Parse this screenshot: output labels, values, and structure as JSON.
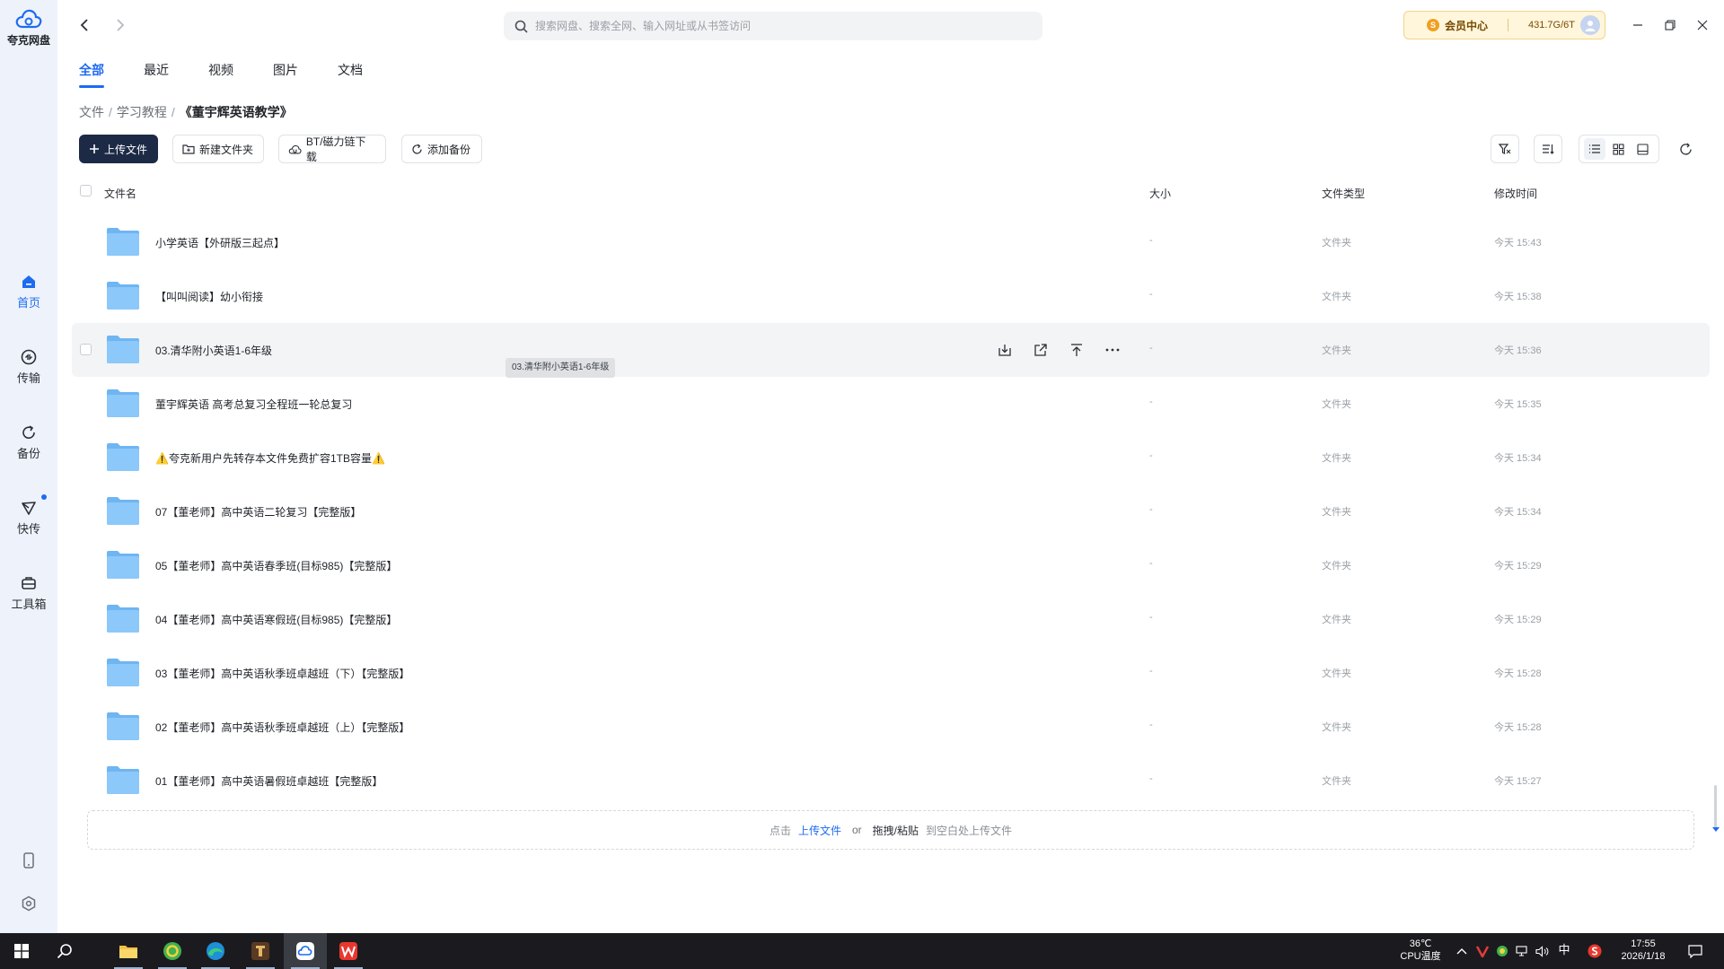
{
  "app": {
    "logo_text": "夸克网盘",
    "brand_color": "#1e6bf2"
  },
  "rail": {
    "items": [
      {
        "label": "首页",
        "icon": "home-icon",
        "active": true
      },
      {
        "label": "传输",
        "icon": "transfer-icon",
        "active": false
      },
      {
        "label": "备份",
        "icon": "backup-icon",
        "active": false
      },
      {
        "label": "快传",
        "icon": "quick-send-icon",
        "active": false
      },
      {
        "label": "工具箱",
        "icon": "toolbox-icon",
        "active": false
      }
    ],
    "bottom_icons": [
      "phone-icon",
      "settings-icon"
    ]
  },
  "header": {
    "search_placeholder": "搜索网盘、搜索全网、输入网址或从书签访问",
    "vip_label": "会员中心",
    "storage": "431.7G/6T"
  },
  "tabs": [
    {
      "label": "全部",
      "active": true
    },
    {
      "label": "最近",
      "active": false
    },
    {
      "label": "视频",
      "active": false
    },
    {
      "label": "图片",
      "active": false
    },
    {
      "label": "文档",
      "active": false
    }
  ],
  "breadcrumb": [
    "文件",
    "学习教程",
    "《董宇辉英语教学》"
  ],
  "toolbar": {
    "upload": "上传文件",
    "new_folder": "新建文件夹",
    "bt": "BT/磁力链下载",
    "backup": "添加备份"
  },
  "table": {
    "headers": {
      "name": "文件名",
      "size": "大小",
      "type": "文件类型",
      "modified": "修改时间"
    },
    "rows": [
      {
        "name": "小学英语【外研版三起点】",
        "size": "-",
        "type": "文件夹",
        "modified": "今天 15:43"
      },
      {
        "name": "【叫叫阅读】幼小衔接",
        "size": "-",
        "type": "文件夹",
        "modified": "今天 15:38"
      },
      {
        "name": "03.清华附小英语1-6年级",
        "size": "-",
        "type": "文件夹",
        "modified": "今天 15:36"
      },
      {
        "name": "董宇辉英语 高考总复习全程班一轮总复习",
        "size": "-",
        "type": "文件夹",
        "modified": "今天 15:35"
      },
      {
        "name": "⚠️夸克新用户先转存本文件免费扩容1TB容量⚠️",
        "size": "-",
        "type": "文件夹",
        "modified": "今天 15:34"
      },
      {
        "name": "07【董老师】高中英语二轮复习【完整版】",
        "size": "-",
        "type": "文件夹",
        "modified": "今天 15:34"
      },
      {
        "name": "05【董老师】高中英语春季班(目标985)【完整版】",
        "size": "-",
        "type": "文件夹",
        "modified": "今天 15:29"
      },
      {
        "name": "04【董老师】高中英语寒假班(目标985)【完整版】",
        "size": "-",
        "type": "文件夹",
        "modified": "今天 15:29"
      },
      {
        "name": "03【董老师】高中英语秋季班卓越班（下）【完整版】",
        "size": "-",
        "type": "文件夹",
        "modified": "今天 15:28"
      },
      {
        "name": "02【董老师】高中英语秋季班卓越班（上）【完整版】",
        "size": "-",
        "type": "文件夹",
        "modified": "今天 15:28"
      },
      {
        "name": "01【董老师】高中英语暑假班卓越班【完整版】",
        "size": "-",
        "type": "文件夹",
        "modified": "今天 15:27"
      }
    ],
    "hover_row_index": 2,
    "tooltip": "03.清华附小英语1-6年级"
  },
  "dropzone": {
    "prefix": "点击",
    "upload_link": "上传文件",
    "or": "or",
    "drag": "拖拽/粘贴",
    "suffix": "到空白处上传文件"
  },
  "taskbar": {
    "temperature": "36℃",
    "temp_label": "CPU温度",
    "ime": "中",
    "time": "17:55",
    "date": "2026/1/18"
  }
}
